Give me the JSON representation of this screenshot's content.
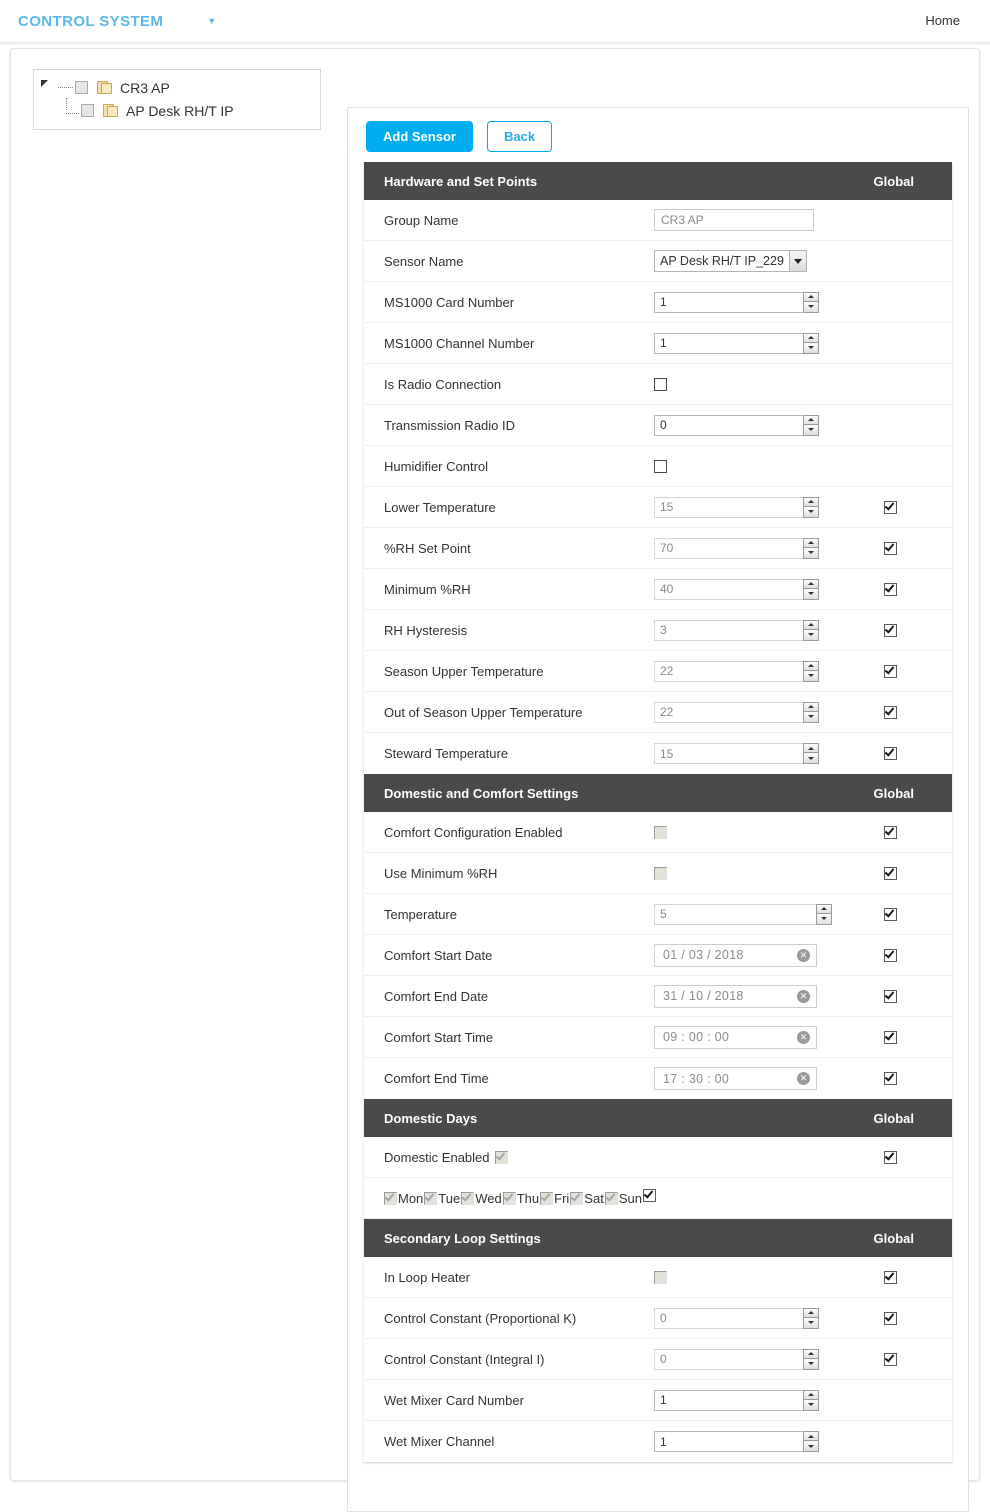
{
  "navbar": {
    "brand": "CONTROL SYSTEM",
    "caret_icon": "chevron-down-icon",
    "home_link": "Home"
  },
  "tree": {
    "nodes": [
      {
        "label": "CR3 AP",
        "level": 0,
        "checked": false,
        "icon": "folder-icon",
        "toggle": "expanded-triangle-icon"
      },
      {
        "label": "AP Desk RH/T IP",
        "level": 1,
        "checked": false,
        "icon": "folder-icon",
        "toggle": "leaf-elbow-icon"
      }
    ]
  },
  "toolbar": {
    "add_sensor_label": "Add Sensor",
    "back_label": "Back"
  },
  "colors": {
    "accent": "#00aeef",
    "accent_text": "#29abe2",
    "panel_header_bg": "#4a4a48",
    "brand": "#5bb8e8"
  },
  "panels": [
    {
      "title": "Hardware and Set Points",
      "global_label": "Global",
      "rows": [
        {
          "label": "Group Name",
          "type": "text",
          "value": "CR3 AP",
          "global": null
        },
        {
          "label": "Sensor Name",
          "type": "select",
          "value": "AP Desk RH/T IP_229",
          "global": null
        },
        {
          "label": "MS1000 Card Number",
          "type": "number",
          "value": "1",
          "enabled": true,
          "global": null
        },
        {
          "label": "MS1000 Channel Number",
          "type": "number",
          "value": "1",
          "enabled": true,
          "global": null
        },
        {
          "label": "Is Radio Connection",
          "type": "checkbox",
          "value": false,
          "style": "plain",
          "global": null
        },
        {
          "label": "Transmission Radio ID",
          "type": "number",
          "value": "0",
          "enabled": true,
          "global": null
        },
        {
          "label": "Humidifier Control",
          "type": "checkbox",
          "value": false,
          "style": "plain",
          "global": null
        },
        {
          "label": "Lower Temperature",
          "type": "number",
          "value": "15",
          "enabled": false,
          "global": true
        },
        {
          "label": "%RH Set Point",
          "type": "number",
          "value": "70",
          "enabled": false,
          "global": true
        },
        {
          "label": "Minimum %RH",
          "type": "number",
          "value": "40",
          "enabled": false,
          "global": true
        },
        {
          "label": "RH Hysteresis",
          "type": "number",
          "value": "3",
          "enabled": false,
          "global": true
        },
        {
          "label": "Season Upper Temperature",
          "type": "number",
          "value": "22",
          "enabled": false,
          "global": true
        },
        {
          "label": "Out of Season Upper Temperature",
          "type": "number",
          "value": "22",
          "enabled": false,
          "global": true
        },
        {
          "label": "Steward Temperature",
          "type": "number",
          "value": "15",
          "enabled": false,
          "global": true
        }
      ]
    },
    {
      "title": "Domestic and Comfort Settings",
      "global_label": "Global",
      "rows": [
        {
          "label": "Comfort Configuration Enabled",
          "type": "checkbox",
          "value": false,
          "style": "disabled",
          "global": true
        },
        {
          "label": "Use Minimum %RH",
          "type": "checkbox",
          "value": false,
          "style": "disabled",
          "global": true
        },
        {
          "label": "Temperature",
          "type": "number",
          "value": "5",
          "enabled": false,
          "wide": true,
          "global": true
        },
        {
          "label": "Comfort Start Date",
          "type": "date",
          "value": "01 / 03 / 2018",
          "global": true
        },
        {
          "label": "Comfort End Date",
          "type": "date",
          "value": "31 / 10 / 2018",
          "global": true
        },
        {
          "label": "Comfort Start Time",
          "type": "date",
          "value": "09 : 00 : 00",
          "global": true
        },
        {
          "label": "Comfort End Time",
          "type": "date",
          "value": "17 : 30 : 00",
          "global": true
        }
      ]
    },
    {
      "title": "Domestic Days",
      "global_label": "Global",
      "rows": [
        {
          "label": "Domestic Enabled",
          "type": "inline-checkbox",
          "value": true,
          "style": "disabled",
          "global": true
        }
      ],
      "days": {
        "global": true,
        "items": [
          {
            "label": "Mon",
            "checked": true
          },
          {
            "label": "Tue",
            "checked": true
          },
          {
            "label": "Wed",
            "checked": true
          },
          {
            "label": "Thu",
            "checked": true
          },
          {
            "label": "Fri",
            "checked": true
          },
          {
            "label": "Sat",
            "checked": true
          },
          {
            "label": "Sun",
            "checked": true
          }
        ]
      }
    },
    {
      "title": "Secondary Loop Settings",
      "global_label": "Global",
      "rows": [
        {
          "label": "In Loop Heater",
          "type": "checkbox",
          "value": false,
          "style": "disabled",
          "global": true
        },
        {
          "label": "Control Constant (Proportional K)",
          "type": "number",
          "value": "0",
          "enabled": false,
          "global": true
        },
        {
          "label": "Control Constant (Integral I)",
          "type": "number",
          "value": "0",
          "enabled": false,
          "global": true
        },
        {
          "label": "Wet Mixer Card Number",
          "type": "number",
          "value": "1",
          "enabled": true,
          "global": null
        },
        {
          "label": "Wet Mixer Channel",
          "type": "number",
          "value": "1",
          "enabled": true,
          "global": null
        }
      ]
    }
  ]
}
